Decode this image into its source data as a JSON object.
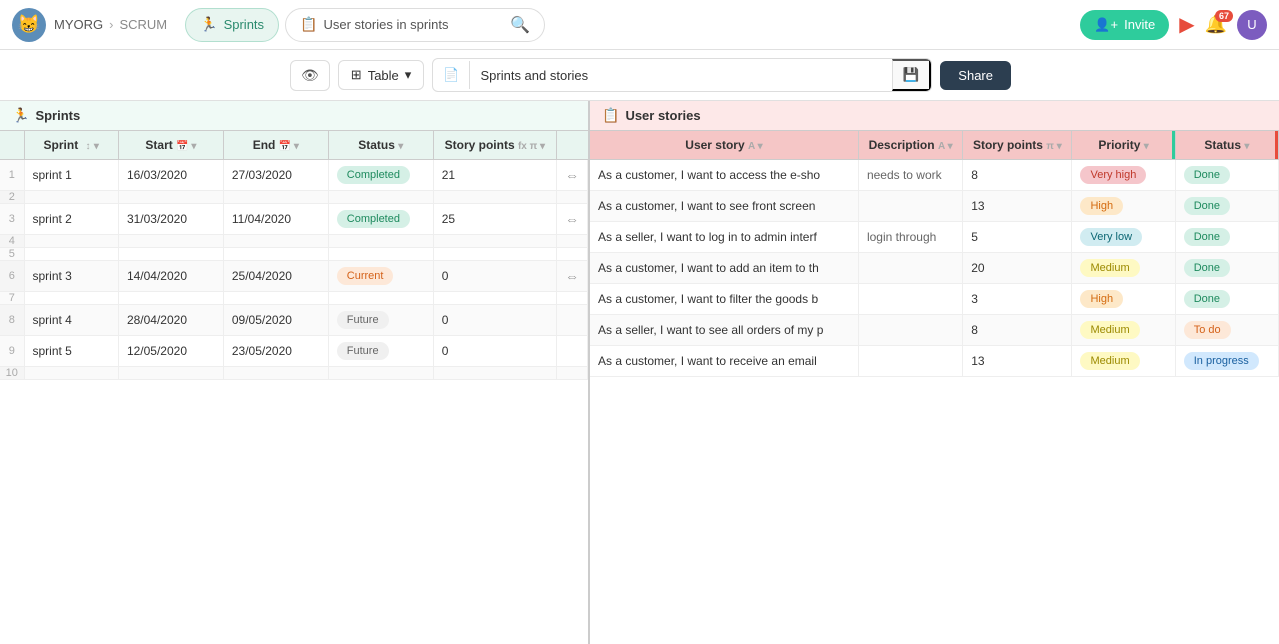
{
  "nav": {
    "org": "MYORG",
    "sep": "›",
    "project": "SCRUM",
    "tabs": [
      {
        "id": "sprints",
        "label": "Sprints",
        "icon": "🏃",
        "active": true
      },
      {
        "id": "stories",
        "label": "User stories in sprints",
        "icon": "📋",
        "active": false
      }
    ],
    "search_placeholder": "User stories in sprints",
    "invite_label": "Invite",
    "notif_count": "67"
  },
  "toolbar": {
    "table_label": "Table",
    "view_title": "Sprints and stories",
    "share_label": "Share"
  },
  "sprints": {
    "section_label": "Sprints",
    "columns": [
      "Sprint",
      "Start",
      "End",
      "Status",
      "Story points"
    ],
    "rows": [
      {
        "num": 1,
        "sprint": "sprint 1",
        "start": "16/03/2020",
        "end": "27/03/2020",
        "status": "Completed",
        "points": 21
      },
      {
        "num": 2,
        "sprint": "",
        "start": "",
        "end": "",
        "status": "",
        "points": ""
      },
      {
        "num": 3,
        "sprint": "sprint 2",
        "start": "31/03/2020",
        "end": "11/04/2020",
        "status": "Completed",
        "points": 25
      },
      {
        "num": 4,
        "sprint": "",
        "start": "",
        "end": "",
        "status": "",
        "points": ""
      },
      {
        "num": 5,
        "sprint": "",
        "start": "",
        "end": "",
        "status": "",
        "points": ""
      },
      {
        "num": 6,
        "sprint": "sprint 3",
        "start": "14/04/2020",
        "end": "25/04/2020",
        "status": "Current",
        "points": 0
      },
      {
        "num": 7,
        "sprint": "",
        "start": "",
        "end": "",
        "status": "",
        "points": ""
      },
      {
        "num": 8,
        "sprint": "sprint 4",
        "start": "28/04/2020",
        "end": "09/05/2020",
        "status": "Future",
        "points": 0
      },
      {
        "num": 9,
        "sprint": "sprint 5",
        "start": "12/05/2020",
        "end": "23/05/2020",
        "status": "Future",
        "points": 0
      },
      {
        "num": 10,
        "sprint": "",
        "start": "",
        "end": "",
        "status": "",
        "points": ""
      }
    ]
  },
  "stories": {
    "section_label": "User stories",
    "columns": [
      "User story",
      "Description",
      "Story points",
      "Priority",
      "Status"
    ],
    "rows": [
      {
        "story": "As a customer, I want to access the e-sho",
        "description": "needs to work",
        "points": 8,
        "priority": "Very high",
        "status": "Done"
      },
      {
        "story": "As a customer, I want to see front screen",
        "description": "",
        "points": 13,
        "priority": "High",
        "status": "Done"
      },
      {
        "story": "As a seller, I want to log in to admin interf",
        "description": "login through",
        "points": 5,
        "priority": "Very low",
        "status": "Done"
      },
      {
        "story": "As a customer, I want to add an item to th",
        "description": "",
        "points": 20,
        "priority": "Medium",
        "status": "Done"
      },
      {
        "story": "As a customer, I want to filter the goods b",
        "description": "",
        "points": 3,
        "priority": "High",
        "status": "Done"
      },
      {
        "story": "As a seller, I want to see all orders of my p",
        "description": "",
        "points": 8,
        "priority": "Medium",
        "status": "To do"
      },
      {
        "story": "As a customer, I want to receive an email",
        "description": "",
        "points": 13,
        "priority": "Medium",
        "status": "In progress"
      }
    ]
  }
}
